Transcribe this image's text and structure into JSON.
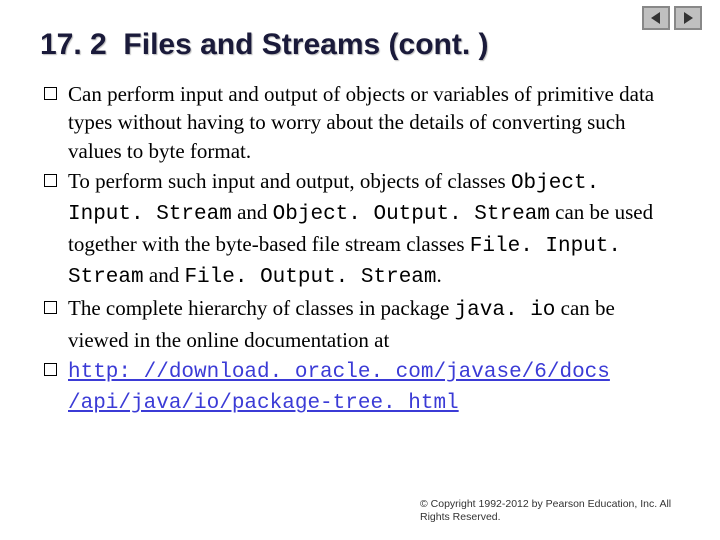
{
  "nav": {
    "prev": "previous-slide",
    "next": "next-slide"
  },
  "title": {
    "number": "17. 2",
    "text": "Files and Streams (cont. )"
  },
  "bullets": [
    {
      "pre": "Can perform input and output of objects or variables of primitive data types without having to worry about the details of converting such values to byte format."
    },
    {
      "pre": "To perform such input and output, objects of classes ",
      "code1": "Object. Input. Stream",
      "mid1": " and ",
      "code2": "Object. Output. Stream",
      "mid2": " can be used together with the byte-based file stream classes ",
      "code3": "File. Input. Stream",
      "mid3": " and ",
      "code4": "File. Output. Stream",
      "post": "."
    },
    {
      "pre": "The complete hierarchy of classes in package ",
      "code1": "java. io",
      "post": " can be viewed in the online documentation at"
    },
    {
      "link": "http: //download. oracle. com/javase/6/docs /api/java/io/package-tree. html"
    }
  ],
  "copyright": "© Copyright 1992-2012 by Pearson Education, Inc. All Rights Reserved."
}
